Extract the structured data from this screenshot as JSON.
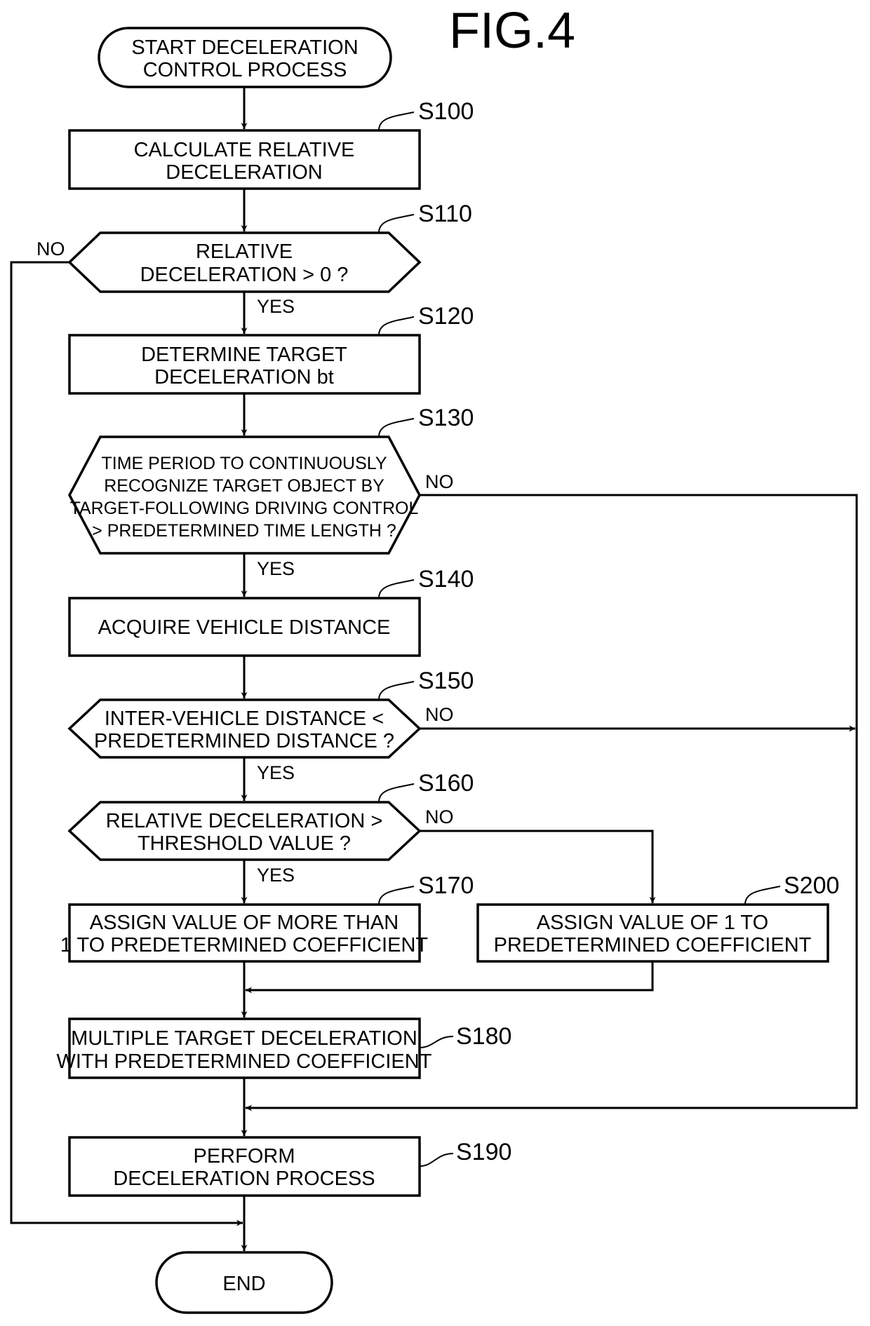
{
  "figure_title": "FIG.4",
  "nodes": {
    "start": {
      "type": "terminal",
      "lines": [
        "START DECELERATION",
        "CONTROL PROCESS"
      ]
    },
    "s100": {
      "type": "process",
      "step": "S100",
      "lines": [
        "CALCULATE RELATIVE",
        "DECELERATION"
      ]
    },
    "s110": {
      "type": "decision",
      "step": "S110",
      "lines": [
        "RELATIVE",
        "DECELERATION > 0 ?"
      ]
    },
    "s120": {
      "type": "process",
      "step": "S120",
      "lines": [
        "DETERMINE TARGET",
        "DECELERATION bt"
      ]
    },
    "s130": {
      "type": "decision",
      "step": "S130",
      "lines": [
        "TIME PERIOD TO CONTINUOUSLY",
        "RECOGNIZE TARGET OBJECT BY",
        "TARGET-FOLLOWING DRIVING CONTROL",
        "> PREDETERMINED TIME LENGTH ?"
      ]
    },
    "s140": {
      "type": "process",
      "step": "S140",
      "lines": [
        "ACQUIRE VEHICLE DISTANCE"
      ]
    },
    "s150": {
      "type": "decision",
      "step": "S150",
      "lines": [
        "INTER-VEHICLE DISTANCE <",
        "PREDETERMINED DISTANCE ?"
      ]
    },
    "s160": {
      "type": "decision",
      "step": "S160",
      "lines": [
        "RELATIVE DECELERATION >",
        "THRESHOLD VALUE ?"
      ]
    },
    "s170": {
      "type": "process",
      "step": "S170",
      "lines": [
        "ASSIGN VALUE OF MORE THAN",
        "1 TO PREDETERMINED COEFFICIENT"
      ]
    },
    "s200": {
      "type": "process",
      "step": "S200",
      "lines": [
        "ASSIGN VALUE OF 1 TO",
        "PREDETERMINED COEFFICIENT"
      ]
    },
    "s180": {
      "type": "process",
      "step": "S180",
      "lines": [
        "MULTIPLE TARGET DECELERATION",
        "WITH PREDETERMINED COEFFICIENT"
      ]
    },
    "s190": {
      "type": "process",
      "step": "S190",
      "lines": [
        "PERFORM",
        "DECELERATION PROCESS"
      ]
    },
    "end": {
      "type": "terminal",
      "lines": [
        "END"
      ]
    }
  },
  "branch_labels": {
    "s110_yes": "YES",
    "s110_no": "NO",
    "s130_yes": "YES",
    "s130_no": "NO",
    "s150_yes": "YES",
    "s150_no": "NO",
    "s160_yes": "YES",
    "s160_no": "NO"
  },
  "edges": [
    {
      "from": "start",
      "to": "s100"
    },
    {
      "from": "s100",
      "to": "s110"
    },
    {
      "from": "s110",
      "to": "s120",
      "label": "YES"
    },
    {
      "from": "s110",
      "to": "end",
      "label": "NO"
    },
    {
      "from": "s120",
      "to": "s130"
    },
    {
      "from": "s130",
      "to": "s140",
      "label": "YES"
    },
    {
      "from": "s130",
      "to": "s190",
      "label": "NO"
    },
    {
      "from": "s140",
      "to": "s150"
    },
    {
      "from": "s150",
      "to": "s160",
      "label": "YES"
    },
    {
      "from": "s150",
      "to": "s190",
      "label": "NO"
    },
    {
      "from": "s160",
      "to": "s170",
      "label": "YES"
    },
    {
      "from": "s160",
      "to": "s200",
      "label": "NO"
    },
    {
      "from": "s170",
      "to": "s180"
    },
    {
      "from": "s200",
      "to": "s180"
    },
    {
      "from": "s180",
      "to": "s190"
    },
    {
      "from": "s190",
      "to": "end"
    }
  ]
}
